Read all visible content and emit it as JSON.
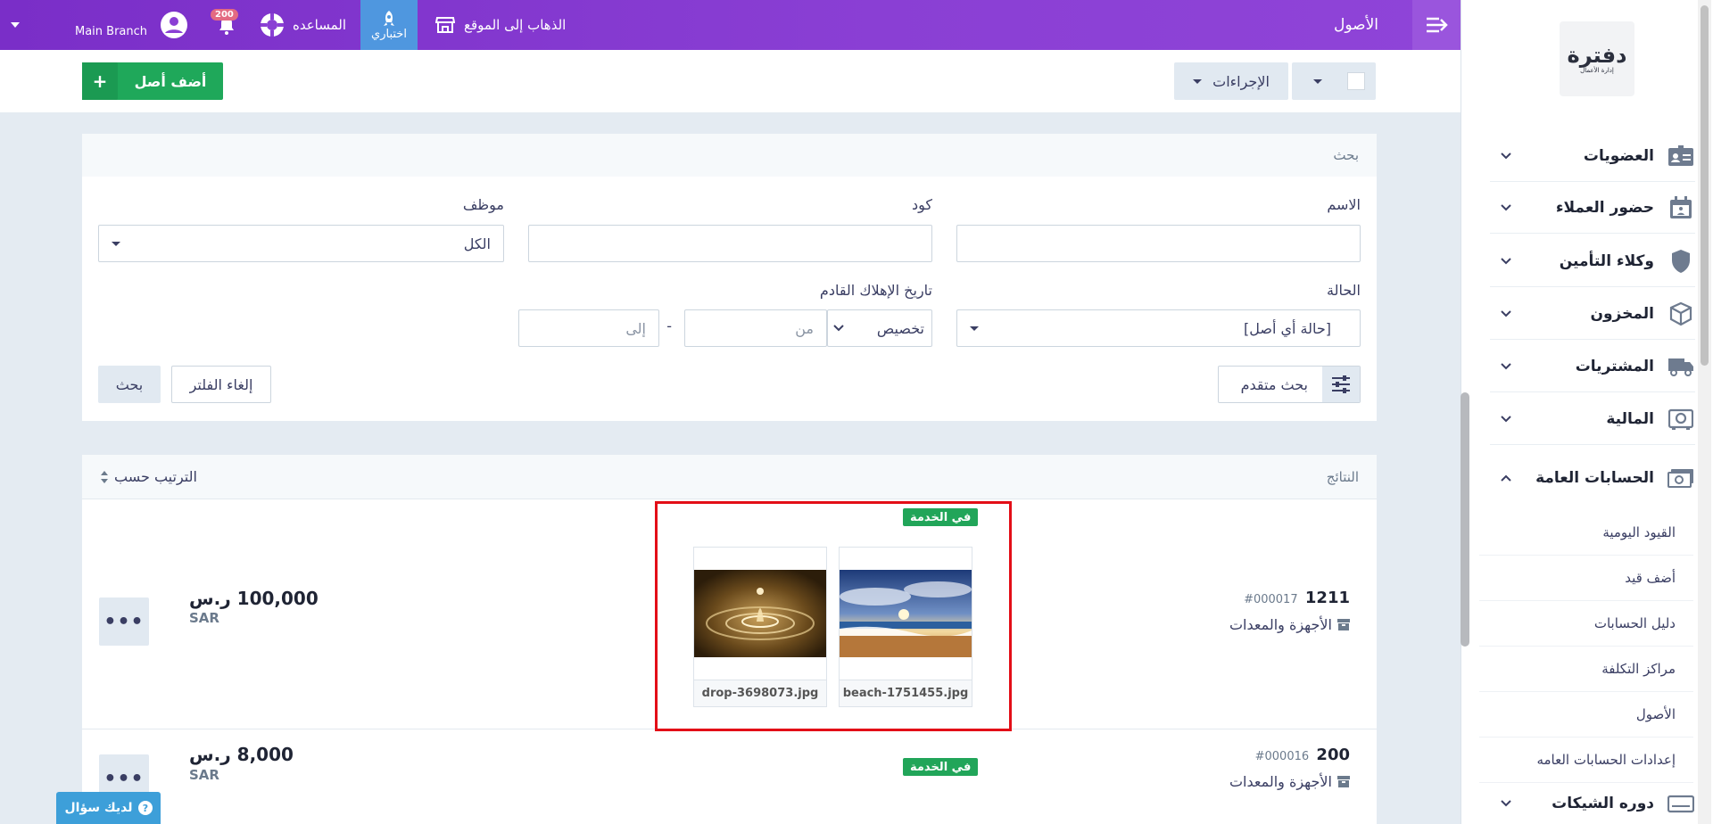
{
  "topbar": {
    "page_title": "الأصول",
    "go_to_site": "الذهاب إلى الموقع",
    "test_mode": "اختباري",
    "help": "المساعده",
    "notifications_count": "200",
    "branch": "Main Branch"
  },
  "sidebar": {
    "logo_text": "دفترة",
    "logo_subtext": "إدارة الأعمال",
    "items": [
      {
        "label": "العضويات",
        "icon": "id-card-icon"
      },
      {
        "label": "حضور العملاء",
        "icon": "calendar-icon"
      },
      {
        "label": "وكلاء التأمين",
        "icon": "shield-icon"
      },
      {
        "label": "المخزون",
        "icon": "box-icon"
      },
      {
        "label": "المشتريات",
        "icon": "truck-icon"
      },
      {
        "label": "المالية",
        "icon": "safe-icon"
      },
      {
        "label": "الحسابات العامة",
        "icon": "money-icon"
      },
      {
        "label": "دوره الشيكات",
        "icon": "check-card-icon"
      }
    ],
    "sub_items": [
      "القيود اليومية",
      "أضف قيد",
      "دليل الحسابات",
      "مراكز التكلفة",
      "الأصول",
      "إعدادات الحسابات العامه"
    ]
  },
  "actions": {
    "add_asset": "أضف أصل",
    "actions_label": "الإجراءات"
  },
  "search": {
    "header": "بحث",
    "name_label": "الاسم",
    "code_label": "كود",
    "employee_label": "موظف",
    "employee_value": "الكل",
    "status_label": "الحالة",
    "status_value": "[حالة أي أصل]",
    "depreciation_label": "تاريخ الإهلاك القادم",
    "date_mode": "تخصيص",
    "from_placeholder": "من",
    "to_placeholder": "إلى",
    "date_sep": "-",
    "advanced": "بحث متقدم",
    "clear_filter": "إلغاء الفلتر",
    "search_btn": "بحث"
  },
  "results": {
    "header": "النتائج",
    "sort_by": "الترتيب حسب",
    "rows": [
      {
        "code": "1211",
        "number": "#000017",
        "category": "الأجهزة والمعدات",
        "status": "في الخدمة",
        "amount": "100,000 ر.س",
        "currency": "SAR",
        "attachments": [
          "beach-1751455.jpg",
          "drop-3698073.jpg"
        ]
      },
      {
        "code": "200",
        "number": "#000016",
        "category": "الأجهزة والمعدات",
        "status": "في الخدمة",
        "amount": "8,000 ر.س",
        "currency": "SAR"
      }
    ]
  },
  "help_button": "لديك سؤال",
  "colors": {
    "topbar": "#8a3fd4",
    "accent_green": "#1fa85a",
    "accent_blue": "#4f97df",
    "highlight_red": "#e30e17"
  }
}
